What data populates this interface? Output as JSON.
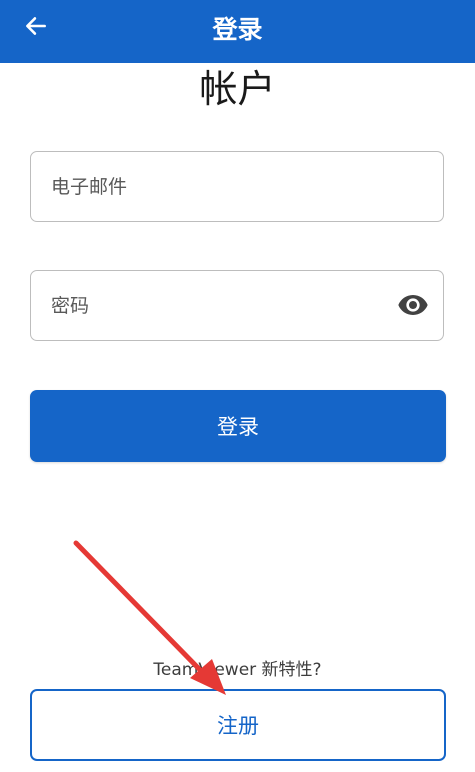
{
  "header": {
    "title": "登录",
    "back_icon": "arrow-left-icon"
  },
  "page_title": "帐户",
  "email": {
    "placeholder": "电子邮件",
    "value": ""
  },
  "password": {
    "placeholder": "密码",
    "value": "",
    "visibility_icon": "eye-icon"
  },
  "login_button": "登录",
  "whats_new": "TeamViewer 新特性?",
  "register_button": "注册",
  "colors": {
    "brand": "#1565c8",
    "annotation": "#e53935"
  }
}
